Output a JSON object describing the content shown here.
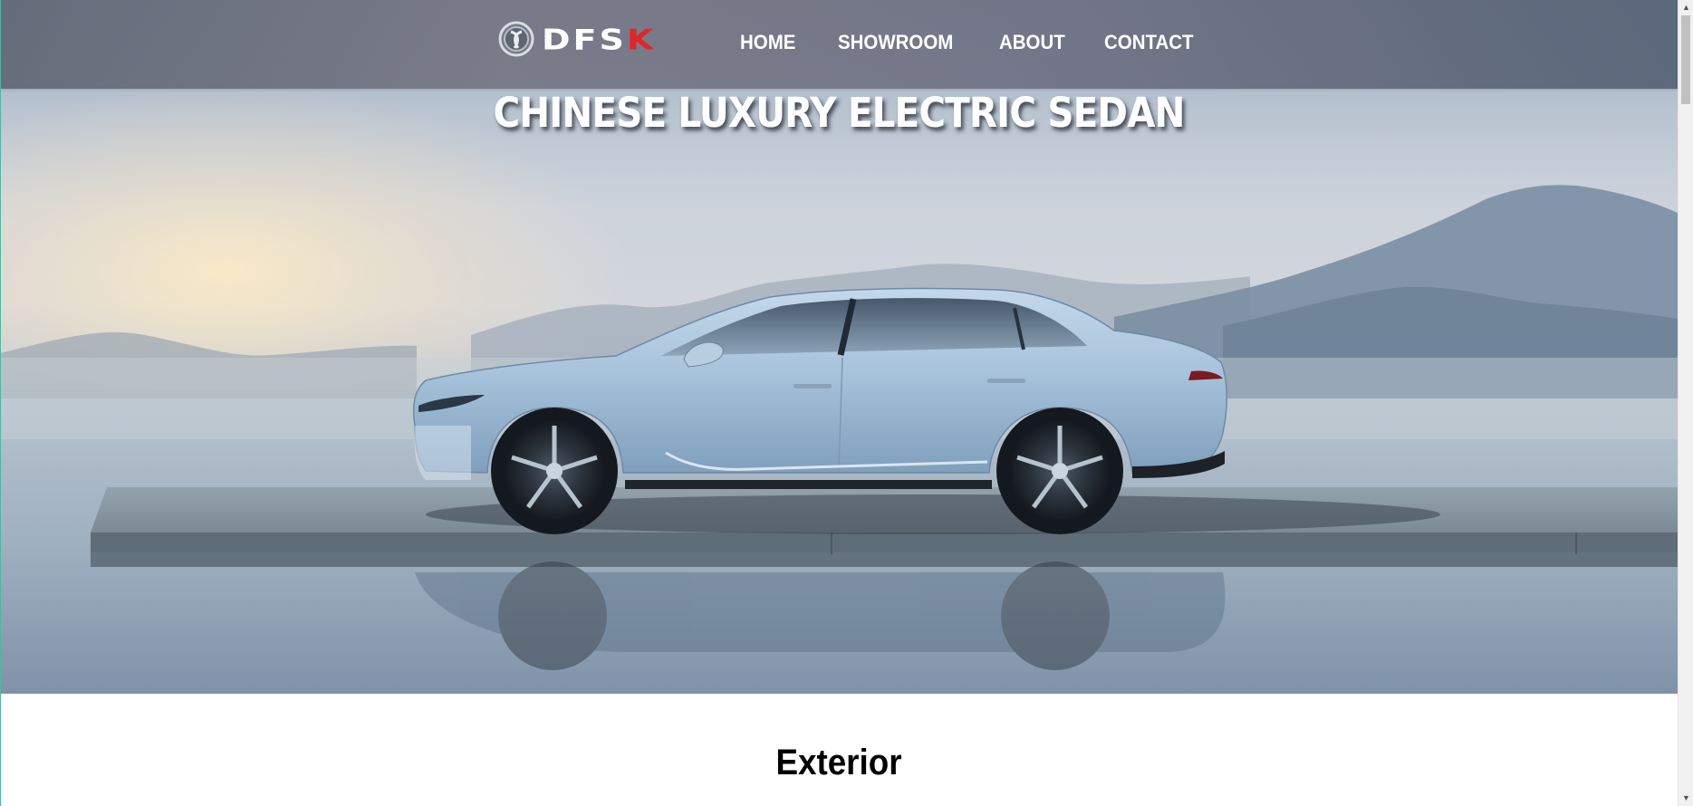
{
  "brand": {
    "logo_text": "DFS",
    "logo_text_accent": "K",
    "accent_color": "#e0262b"
  },
  "nav": {
    "items": [
      {
        "label": "HOME"
      },
      {
        "label": "SHOWROOM"
      },
      {
        "label": "ABOUT"
      },
      {
        "label": "CONTACT"
      }
    ]
  },
  "hero": {
    "title": "CHINESE LUXURY ELECTRIC SEDAN",
    "image_subject": "light-blue electric sedan on a platform over water with misty mountains"
  },
  "sections": {
    "exterior_title": "Exterior"
  },
  "scrollbar": {
    "up_icon": "scroll-up-arrow-icon",
    "down_icon": "scroll-down-arrow-icon"
  }
}
